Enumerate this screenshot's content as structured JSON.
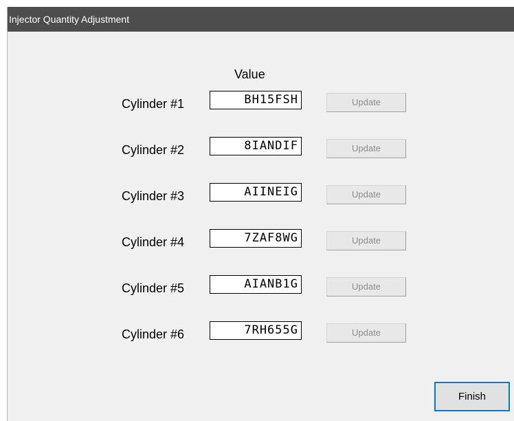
{
  "window": {
    "title": "Injector Quantity Adjustment"
  },
  "columns": {
    "value_header": "Value"
  },
  "cylinders": [
    {
      "label": "Cylinder #1",
      "value": "BH15FSH",
      "button": "Update",
      "button_enabled": false
    },
    {
      "label": "Cylinder #2",
      "value": "8IANDIF",
      "button": "Update",
      "button_enabled": false
    },
    {
      "label": "Cylinder #3",
      "value": "AIINEIG",
      "button": "Update",
      "button_enabled": false
    },
    {
      "label": "Cylinder #4",
      "value": "7ZAF8WG",
      "button": "Update",
      "button_enabled": false
    },
    {
      "label": "Cylinder #5",
      "value": "AIANB1G",
      "button": "Update",
      "button_enabled": false
    },
    {
      "label": "Cylinder #6",
      "value": "7RH655G",
      "button": "Update",
      "button_enabled": false
    }
  ],
  "footer": {
    "finish_label": "Finish"
  },
  "colors": {
    "titlebar": "#4d4d4d",
    "window_bg": "#f0f0f0",
    "focus_border": "#0078d7",
    "disabled_text": "#8c8c8c"
  }
}
